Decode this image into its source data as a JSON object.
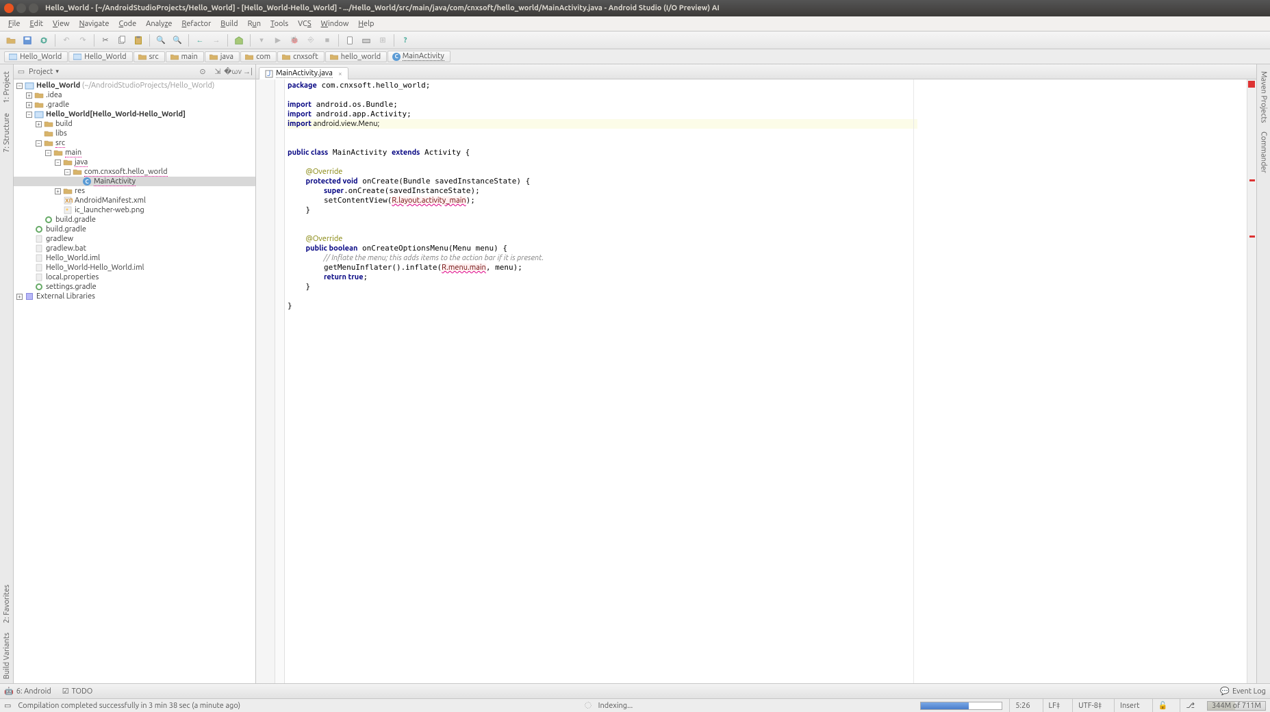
{
  "window": {
    "title": "Hello_World - [~/AndroidStudioProjects/Hello_World] - [Hello_World-Hello_World] - .../Hello_World/src/main/java/com/cnxsoft/hello_world/MainActivity.java - Android Studio (I/O Preview) AI"
  },
  "menu": {
    "items": [
      "File",
      "Edit",
      "View",
      "Navigate",
      "Code",
      "Analyze",
      "Refactor",
      "Build",
      "Run",
      "Tools",
      "VCS",
      "Window",
      "Help"
    ]
  },
  "breadcrumb": {
    "items": [
      {
        "label": "Hello_World",
        "icon": "module"
      },
      {
        "label": "Hello_World",
        "icon": "module"
      },
      {
        "label": "src",
        "icon": "folder"
      },
      {
        "label": "main",
        "icon": "folder"
      },
      {
        "label": "java",
        "icon": "folder"
      },
      {
        "label": "com",
        "icon": "folder"
      },
      {
        "label": "cnxsoft",
        "icon": "folder"
      },
      {
        "label": "hello_world",
        "icon": "folder"
      },
      {
        "label": "MainActivity",
        "icon": "class",
        "selected": true
      }
    ]
  },
  "left_rail": {
    "items": [
      "1: Project",
      "7: Structure",
      "2: Favorites",
      "Build Variants"
    ]
  },
  "right_rail": {
    "items": [
      "Maven Projects",
      "Commander"
    ]
  },
  "project_panel": {
    "title": "Project",
    "root_label": "Hello_World",
    "root_path": "(~/AndroidStudioProjects/Hello_World)",
    "nodes": [
      {
        "indent": 1,
        "exp": "+",
        "icon": "folder",
        "label": ".idea"
      },
      {
        "indent": 1,
        "exp": "+",
        "icon": "folder",
        "label": ".gradle"
      },
      {
        "indent": 1,
        "exp": "-",
        "icon": "module",
        "label": "Hello_World",
        "suffix": "[Hello_World-Hello_World]",
        "bold": true
      },
      {
        "indent": 2,
        "exp": "+",
        "icon": "folder",
        "label": "build"
      },
      {
        "indent": 2,
        "exp": "",
        "icon": "folder",
        "label": "libs"
      },
      {
        "indent": 2,
        "exp": "-",
        "icon": "folder",
        "label": "src",
        "us": true
      },
      {
        "indent": 3,
        "exp": "-",
        "icon": "folder",
        "label": "main",
        "us": true
      },
      {
        "indent": 4,
        "exp": "-",
        "icon": "folder",
        "label": "java",
        "us": true
      },
      {
        "indent": 5,
        "exp": "-",
        "icon": "folder",
        "label": "com.cnxsoft.hello_world",
        "us": true
      },
      {
        "indent": 6,
        "exp": "",
        "icon": "class",
        "label": "MainActivity",
        "us": true,
        "selected": true
      },
      {
        "indent": 4,
        "exp": "+",
        "icon": "folder",
        "label": "res"
      },
      {
        "indent": 4,
        "exp": "",
        "icon": "xml",
        "label": "AndroidManifest.xml"
      },
      {
        "indent": 4,
        "exp": "",
        "icon": "img",
        "label": "ic_launcher-web.png"
      },
      {
        "indent": 2,
        "exp": "",
        "icon": "gradle",
        "label": "build.gradle"
      },
      {
        "indent": 1,
        "exp": "",
        "icon": "gradle",
        "label": "build.gradle"
      },
      {
        "indent": 1,
        "exp": "",
        "icon": "file",
        "label": "gradlew"
      },
      {
        "indent": 1,
        "exp": "",
        "icon": "file",
        "label": "gradlew.bat"
      },
      {
        "indent": 1,
        "exp": "",
        "icon": "file",
        "label": "Hello_World.iml"
      },
      {
        "indent": 1,
        "exp": "",
        "icon": "file",
        "label": "Hello_World-Hello_World.iml"
      },
      {
        "indent": 1,
        "exp": "",
        "icon": "file",
        "label": "local.properties"
      },
      {
        "indent": 1,
        "exp": "",
        "icon": "gradle",
        "label": "settings.gradle"
      },
      {
        "indent": 0,
        "exp": "+",
        "icon": "lib",
        "label": "External Libraries"
      }
    ]
  },
  "editor": {
    "tab_label": "MainActivity.java",
    "code_lines": [
      {
        "t": "package",
        "rest": " com.cnxsoft.hello_world;"
      },
      {
        "blank": true
      },
      {
        "t": "import",
        "rest": " android.os.Bundle;"
      },
      {
        "t": "import",
        "rest": " android.app.Activity;"
      },
      {
        "t": "import",
        "rest": " android.view.Menu;",
        "hl": true
      },
      {
        "blank": true
      },
      {
        "raw": "<span class='k'>public class</span> MainActivity <span class='k'>extends</span> Activity {"
      },
      {
        "blank": true
      },
      {
        "raw": "    <span class='a'>@Override</span>"
      },
      {
        "raw": "    <span class='k'>protected void</span> onCreate(Bundle savedInstanceState) {"
      },
      {
        "raw": "        <span class='k'>super</span>.onCreate(savedInstanceState);"
      },
      {
        "raw": "        setContentView(<span class='r'>R.layout.activity_main</span>);"
      },
      {
        "raw": "    }"
      },
      {
        "blank": true
      },
      {
        "blank": true
      },
      {
        "raw": "    <span class='a'>@Override</span>"
      },
      {
        "raw": "    <span class='k'>public boolean</span> onCreateOptionsMenu(Menu menu) {"
      },
      {
        "raw": "        <span class='c'>// Inflate the menu; this adds items to the action bar if it is present.</span>"
      },
      {
        "raw": "        getMenuInflater().inflate(<span class='r'>R.menu.main</span>, menu);"
      },
      {
        "raw": "        <span class='k'>return true</span>;"
      },
      {
        "raw": "    }"
      },
      {
        "blank": true
      },
      {
        "raw": "}"
      }
    ]
  },
  "bottom_tools": {
    "left": [
      {
        "label": "6: Android",
        "icon": "android"
      },
      {
        "label": "TODO",
        "icon": "todo"
      }
    ],
    "right_label": "Event Log"
  },
  "status": {
    "message": "Compilation completed successfully in 3 min 38 sec (a minute ago)",
    "indexing": "Indexing...",
    "pos": "5:26",
    "line_sep": "LF",
    "encoding": "UTF-8",
    "mode": "Insert",
    "mem": "344M of 711M"
  }
}
